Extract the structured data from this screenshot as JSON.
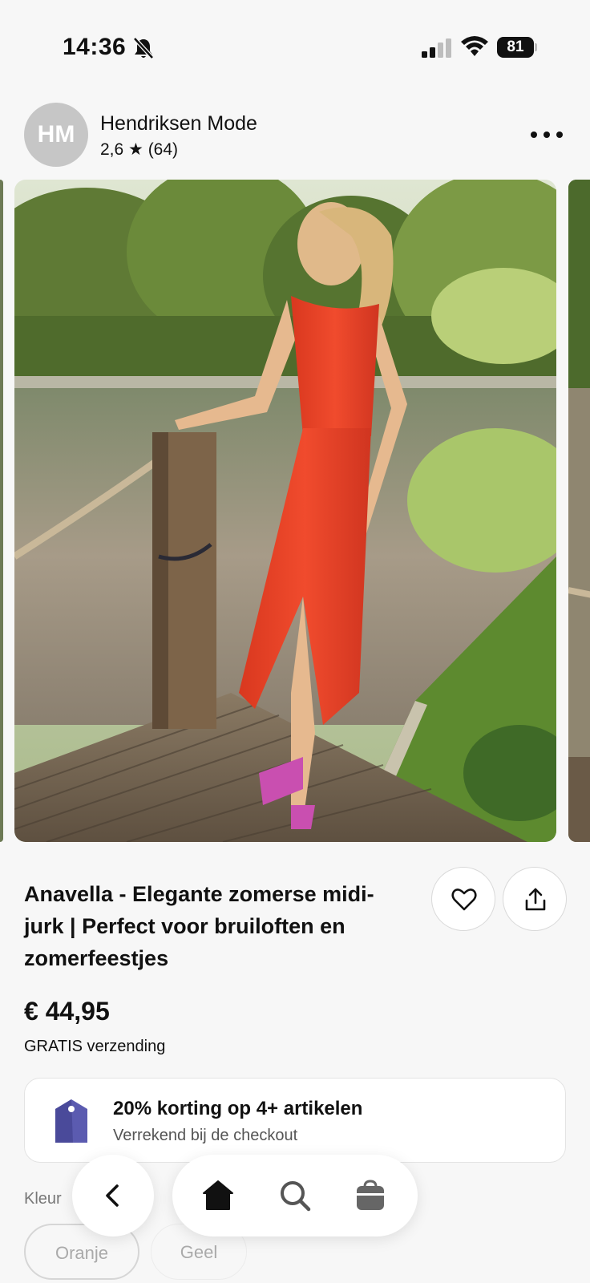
{
  "status_bar": {
    "time": "14:36",
    "battery": "81"
  },
  "shop": {
    "avatar_initials": "HM",
    "name": "Hendriksen Mode",
    "rating": "2,6 ★ (64)"
  },
  "product": {
    "title": "Anavella - Elegante zomerse midi-jurk | Perfect voor bruiloften en zomerfeestjes",
    "price": "€ 44,95",
    "shipping": "GRATIS verzending"
  },
  "promo": {
    "title": "20% korting op 4+ artikelen",
    "subtitle": "Verrekend bij de checkout"
  },
  "color_options": {
    "label": "Kleur",
    "options": [
      "Oranje",
      "Geel"
    ]
  },
  "icons": {
    "bell": "bell-off-icon",
    "favorite": "heart-icon",
    "share": "share-icon",
    "promo": "price-tag-icon",
    "back": "chevron-left-icon",
    "home": "home-icon",
    "search": "search-icon",
    "cart": "cart-icon"
  },
  "colors": {
    "dress": "#e8442a",
    "tag": "#5b5bb0"
  }
}
